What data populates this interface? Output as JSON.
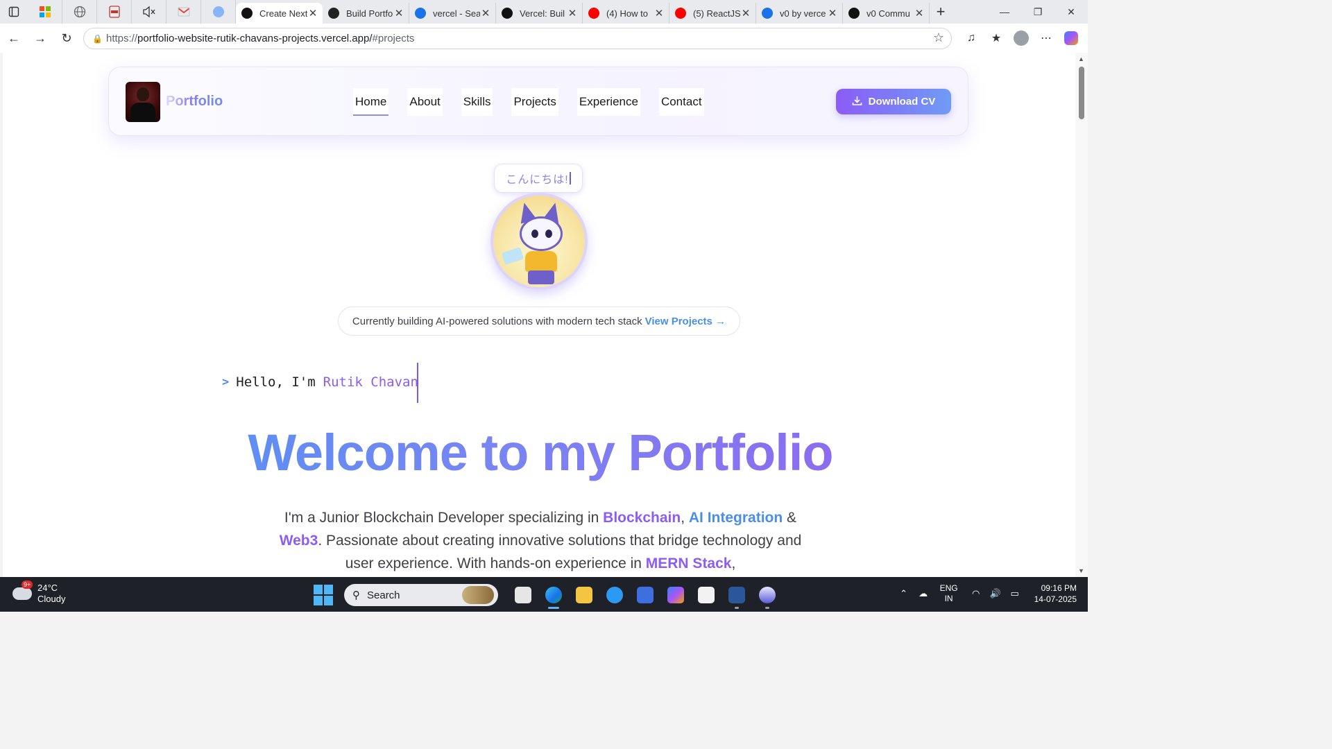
{
  "browser": {
    "tabs": [
      {
        "title": "Create Next",
        "active": true,
        "fav_color": "#111111"
      },
      {
        "title": "Build Portfo",
        "active": false,
        "fav_color": "#222222"
      },
      {
        "title": "vercel - Sea",
        "active": false,
        "fav_color": "#1a73e8"
      },
      {
        "title": "Vercel: Buil",
        "active": false,
        "fav_color": "#111111"
      },
      {
        "title": "(4) How to",
        "active": false,
        "fav_color": "#ff0000"
      },
      {
        "title": "(5) ReactJS",
        "active": false,
        "fav_color": "#ff0000"
      },
      {
        "title": "v0 by verce",
        "active": false,
        "fav_color": "#1a73e8"
      },
      {
        "title": "v0 Commu",
        "active": false,
        "fav_color": "#111111"
      }
    ],
    "address": {
      "scheme": "https://",
      "host": "portfolio-website-rutik-chavans-projects.vercel.app/",
      "hash": "#projects"
    }
  },
  "site": {
    "logo_text": "Portfolio",
    "nav": [
      {
        "label": "Home",
        "active": true
      },
      {
        "label": "About",
        "active": false
      },
      {
        "label": "Skills",
        "active": false
      },
      {
        "label": "Projects",
        "active": false
      },
      {
        "label": "Experience",
        "active": false
      },
      {
        "label": "Contact",
        "active": false
      }
    ],
    "download_cv": "Download CV",
    "greeting": "こんにちは!",
    "status_text": "Currently building AI-powered solutions with modern tech stack",
    "status_link": "View Projects →",
    "terminal": {
      "prompt": ">",
      "prefix": "Hello, I'm",
      "name": "Rutik Chavan"
    },
    "hero_title": "Welcome to my Portfolio",
    "intro": {
      "part1": "I'm a Junior Blockchain Developer specializing in ",
      "hl1": "Blockchain",
      "sep1": ", ",
      "hl2": "AI Integration",
      "sep2": " & ",
      "hl3": "Web3",
      "part2": ". Passionate about creating innovative solutions that bridge technology and user experience. With hands-on experience in ",
      "hl4": "MERN Stack",
      "part3": ","
    },
    "colors": {
      "accent_purple": "#8b5cf6",
      "accent_blue": "#4b8ee8"
    }
  },
  "taskbar": {
    "weather": {
      "badge": "9+",
      "temp": "24°C",
      "condition": "Cloudy"
    },
    "search_placeholder": "Search",
    "lang": {
      "line1": "ENG",
      "line2": "IN"
    },
    "clock": {
      "time": "09:16 PM",
      "date": "14-07-2025"
    }
  }
}
